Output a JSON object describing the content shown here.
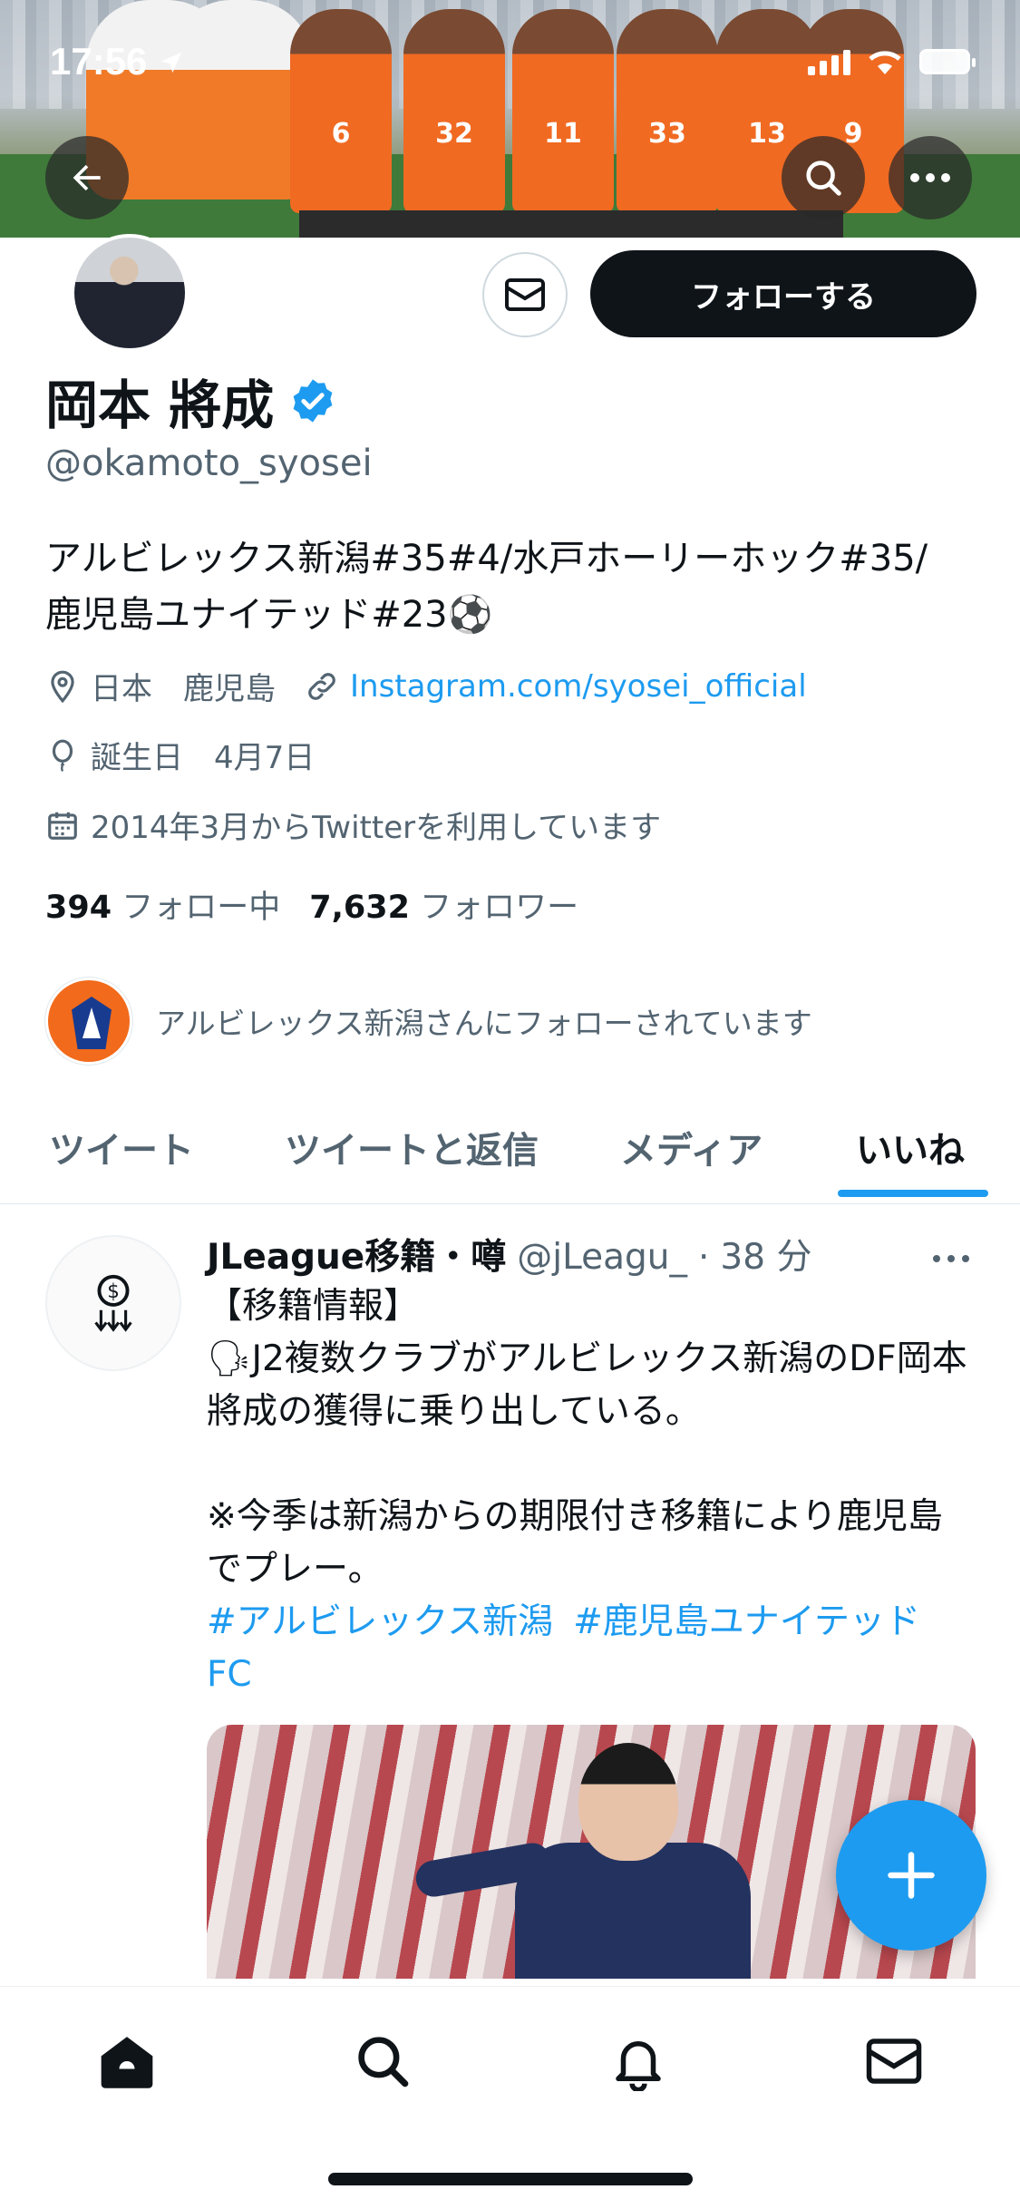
{
  "status_bar": {
    "time": "17:56"
  },
  "profile": {
    "display_name": "岡本 將成",
    "handle": "@okamoto_syosei",
    "bio_line1": "アルビレックス新潟#35#4/水戸ホーリーホック#35/",
    "bio_line2": "鹿児島ユナイテッド#23⚽",
    "location": "日本　鹿児島",
    "website": "Instagram.com/syosei_official",
    "birthday": "誕生日　4月7日",
    "joined": "2014年3月からTwitterを利用しています",
    "following_count": "394",
    "following_label": "フォロー中",
    "followers_count": "7,632",
    "followers_label": "フォロワー",
    "followed_by": "アルビレックス新潟さんにフォローされています",
    "follow_button": "フォローする"
  },
  "banner": {
    "jersey_numbers": [
      "6",
      "32",
      "11",
      "33",
      "13",
      "9"
    ]
  },
  "tabs": [
    {
      "label": "ツイート",
      "active": false
    },
    {
      "label": "ツイートと返信",
      "active": false
    },
    {
      "label": "メディア",
      "active": false
    },
    {
      "label": "いいね",
      "active": true
    }
  ],
  "tweet": {
    "author": "JLeague移籍・噂",
    "handle": "@jLeagu_",
    "separator": "·",
    "time": "38 分",
    "body": "【移籍情報】\n🗣J2複数クラブがアルビレックス新潟のDF岡本將成の獲得に乗り出している。\n\n※今季は新潟からの期限付き移籍により鹿児島でプレー。",
    "hashtags": [
      "#アルビレックス新潟",
      "#鹿児島ユナイテッドFC"
    ]
  },
  "icons": {
    "back": "arrow-left-icon",
    "search": "search-icon",
    "more": "more-horizontal-icon",
    "mail": "mail-icon",
    "verified": "verified-badge-icon",
    "location": "location-pin-icon",
    "link": "link-icon",
    "birthday": "balloon-icon",
    "calendar": "calendar-icon",
    "compose": "plus-icon",
    "nav": [
      "home-icon",
      "search-icon",
      "bell-icon",
      "mail-icon"
    ]
  },
  "colors": {
    "accent": "#1d9bf0",
    "text": "#0f1419",
    "muted": "#536471",
    "follow_button_bg": "#0f1419"
  }
}
